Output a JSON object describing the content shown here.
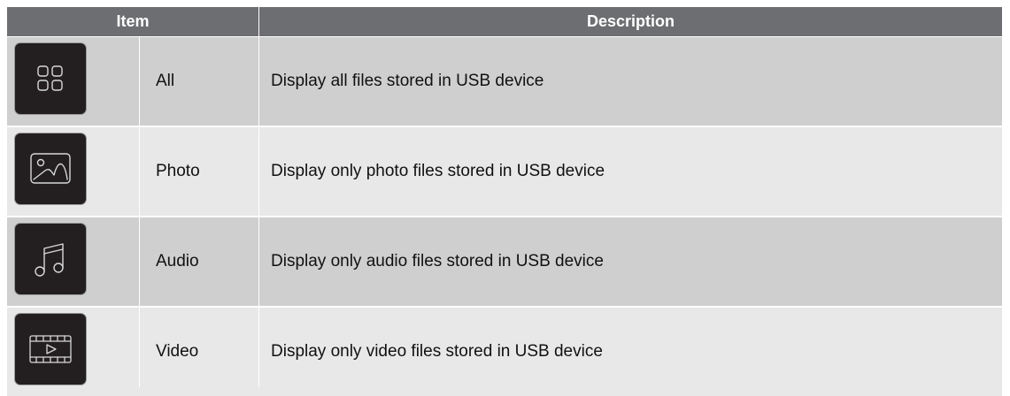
{
  "header": {
    "item_label": "Item",
    "description_label": "Description"
  },
  "rows": [
    {
      "icon": "grid-icon",
      "name": "All",
      "description": "Display all files stored in USB device"
    },
    {
      "icon": "photo-icon",
      "name": "Photo",
      "description": "Display only photo files stored in USB device"
    },
    {
      "icon": "music-note-icon",
      "name": "Audio",
      "description": "Display only audio files stored in USB device"
    },
    {
      "icon": "video-icon",
      "name": "Video",
      "description": "Display only video files stored in USB device"
    }
  ],
  "colors": {
    "header_bg": "#6d6e71",
    "row_dark": "#cfcfd0",
    "row_light": "#e8e8e9",
    "icon_bg": "#231f20"
  }
}
